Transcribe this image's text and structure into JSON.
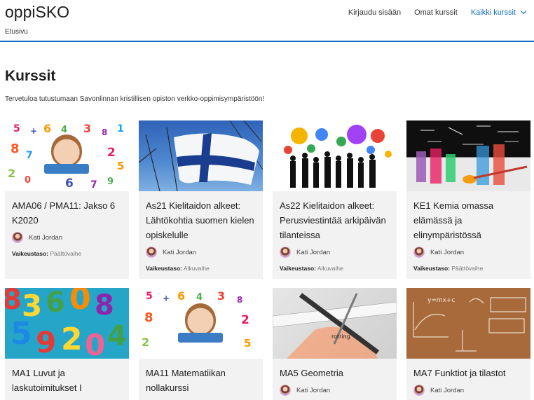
{
  "site": {
    "brand": "oppiSKO",
    "breadcrumb": "Etusivu"
  },
  "nav": {
    "login": "Kirjaudu sisään",
    "my_courses": "Omat kurssit",
    "all_courses": "Kaikki kurssit"
  },
  "page": {
    "title": "Kurssit",
    "welcome": "Tervetuloa tutustumaan Savonlinnan kristillisen opiston verkko-oppimisympäristöön!"
  },
  "level_label": "Vaikeustaso:",
  "courses": [
    {
      "name": "AMA06 / PMA11: Jakso 6 K2020",
      "teacher": "Kati Jordan",
      "level": "Päättövaihe",
      "image": "numbers-boy"
    },
    {
      "name": "As21 Kielitaidon alkeet: Lähtökohtia suomen kielen opiskelulle",
      "teacher": "Kati Jordan",
      "level": "Alkuvaihe",
      "image": "finnish-flag"
    },
    {
      "name": "As22 Kielitaidon alkeet: Perusviestintää arkipäivän tilanteissa",
      "teacher": "Kati Jordan",
      "level": "Alkuvaihe",
      "image": "people-speech-bubbles"
    },
    {
      "name": "KE1 Kemia omassa elämässä ja elinympäristössä",
      "teacher": "Kati Jordan",
      "level": "Päättövaihe",
      "image": "chemistry-flasks"
    },
    {
      "name": "MA1 Luvut ja laskutoimitukset I",
      "image": "number-blocks"
    },
    {
      "name": "MA11 Matematiikan nollakurssi",
      "image": "numbers-boy"
    },
    {
      "name": "MA5 Geometria",
      "teacher": "Kati Jordan",
      "image": "ruler-pen"
    },
    {
      "name": "MA7 Funktiot ja tilastot",
      "teacher": "Kati Jordan",
      "image": "chalkboard-math"
    }
  ],
  "colors": {
    "accent": "#0f6cbf",
    "card_bg": "#f2f2f2"
  }
}
